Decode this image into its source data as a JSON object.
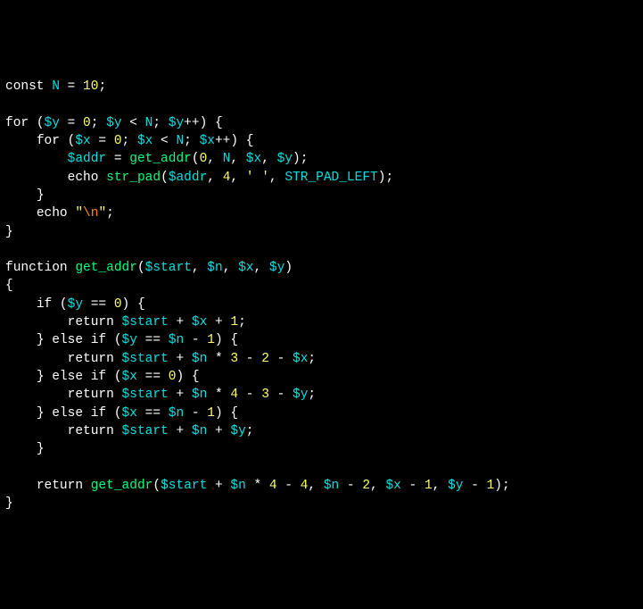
{
  "kw": {
    "const": "const",
    "for": "for",
    "echo": "echo",
    "function": "function",
    "if": "if",
    "else": "else",
    "return": "return"
  },
  "id": {
    "N": "N",
    "get_addr": "get_addr",
    "str_pad": "str_pad",
    "STR_PAD_LEFT": "STR_PAD_LEFT"
  },
  "var": {
    "y": "$y",
    "x": "$x",
    "addr": "$addr",
    "start": "$start",
    "n": "$n"
  },
  "num": {
    "n10": "10",
    "n0": "0",
    "n1": "1",
    "n2": "2",
    "n3": "3",
    "n4": "4"
  },
  "str": {
    "space": "' '",
    "nl_open": "\"",
    "nl_esc": "\\n",
    "nl_close": "\""
  },
  "punct": {
    "assign": " = ",
    "semi": ";",
    "comma": ", ",
    "lp": "(",
    "rp": ")",
    "lb": "{",
    "rb": "}",
    "lt": " < ",
    "inc": "++",
    "eq": " == ",
    "plus": " + ",
    "minus": " - ",
    "star": " * ",
    "sp": " "
  }
}
